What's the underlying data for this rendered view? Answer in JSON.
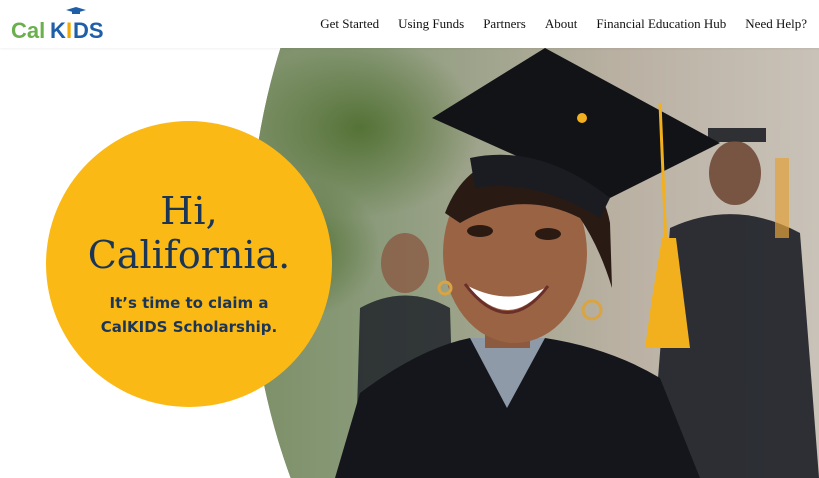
{
  "header": {
    "logo": {
      "text_part1": "Cal",
      "text_part2": "K",
      "text_part3": "I",
      "text_part4": "DS",
      "icon": "graduation-cap-icon"
    },
    "nav": [
      {
        "label": "Get Started"
      },
      {
        "label": "Using Funds"
      },
      {
        "label": "Partners"
      },
      {
        "label": "About"
      },
      {
        "label": "Financial Education Hub"
      },
      {
        "label": "Need Help?"
      }
    ]
  },
  "hero": {
    "headline_line1": "Hi,",
    "headline_line2": "California.",
    "subhead_line1": "It’s time to claim a",
    "subhead_line2": "CalKIDS Scholarship.",
    "image": "smiling-graduate-photo"
  },
  "colors": {
    "brand_yellow": "#fbb916",
    "brand_navy": "#1b3556",
    "logo_green": "#6ab04c",
    "logo_blue": "#1f5fa8"
  }
}
